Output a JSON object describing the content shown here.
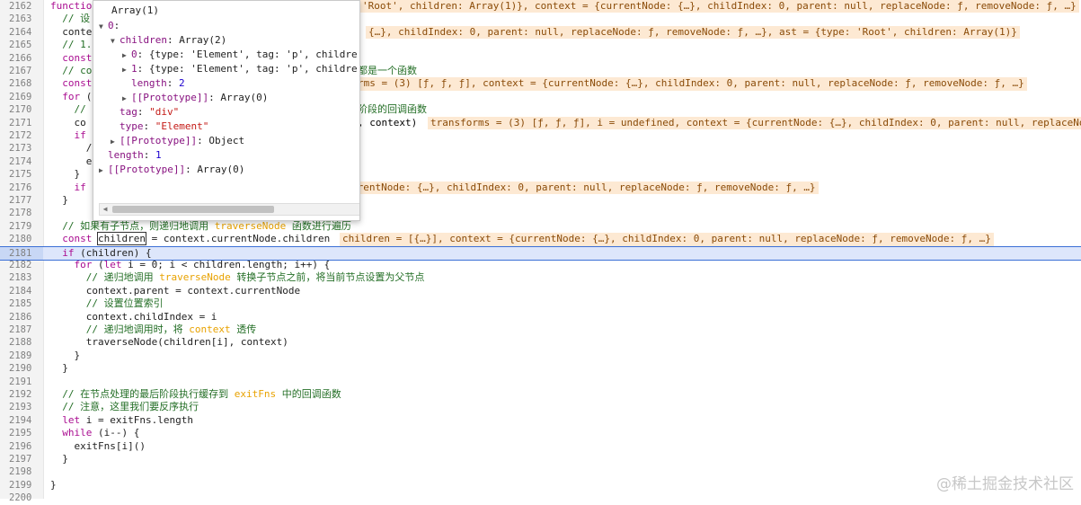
{
  "code": {
    "lines": [
      {
        "n": "2162",
        "t": "functio"
      },
      {
        "n": "2163",
        "t": "  // 设"
      },
      {
        "n": "2164",
        "t": "  conte"
      },
      {
        "n": "2165",
        "t": "  // 1."
      },
      {
        "n": "2166",
        "t": "  const"
      },
      {
        "n": "2167",
        "t": "  // co"
      },
      {
        "n": "2168",
        "t": "  const"
      },
      {
        "n": "2169",
        "t": "  for ("
      },
      {
        "n": "2170",
        "t": "    //"
      },
      {
        "n": "2171",
        "t": "    co"
      },
      {
        "n": "2172",
        "t": "    if"
      },
      {
        "n": "2173",
        "t": "      /"
      },
      {
        "n": "2174",
        "t": "      e"
      },
      {
        "n": "2175",
        "t": "    }"
      },
      {
        "n": "2176",
        "t": "    if"
      },
      {
        "n": "2177",
        "t": "  }"
      },
      {
        "n": "2178",
        "t": ""
      },
      {
        "n": "2179",
        "t": "  // 如果有子节点，则递归地调用 traverseNode 函数进行遍历"
      },
      {
        "n": "2180",
        "t": "  const children = context.currentNode.children"
      },
      {
        "n": "2181",
        "t": "  if (children) {"
      },
      {
        "n": "2182",
        "t": "    for (let i = 0; i < children.length; i++) {"
      },
      {
        "n": "2183",
        "t": "      // 递归地调用 traverseNode 转换子节点之前，将当前节点设置为父节点"
      },
      {
        "n": "2184",
        "t": "      context.parent = context.currentNode"
      },
      {
        "n": "2185",
        "t": "      // 设置位置索引"
      },
      {
        "n": "2186",
        "t": "      context.childIndex = i"
      },
      {
        "n": "2187",
        "t": "      // 递归地调用时，将 context 透传"
      },
      {
        "n": "2188",
        "t": "      traverseNode(children[i], context)"
      },
      {
        "n": "2189",
        "t": "    }"
      },
      {
        "n": "2190",
        "t": "  }"
      },
      {
        "n": "2191",
        "t": ""
      },
      {
        "n": "2192",
        "t": "  // 在节点处理的最后阶段执行缓存到 exitFns 中的回调函数"
      },
      {
        "n": "2193",
        "t": "  // 注意，这里我们要反序执行"
      },
      {
        "n": "2194",
        "t": "  let i = exitFns.length"
      },
      {
        "n": "2195",
        "t": "  while (i--) {"
      },
      {
        "n": "2196",
        "t": "    exitFns[i]()"
      },
      {
        "n": "2197",
        "t": "  }"
      },
      {
        "n": "2198",
        "t": ""
      },
      {
        "n": "2199",
        "t": "}"
      },
      {
        "n": "2200",
        "t": ""
      }
    ],
    "hidden_fragments": {
      "l2167": "都是一个函数",
      "l2170": "阶段的回调函数",
      "l2171": ", context)"
    },
    "inline_values": {
      "l2162": "'Root', children: Array(1)}, context = {currentNode: {…}, childIndex: 0, parent: null, replaceNode: ƒ, removeNode: ƒ, …}",
      "l2164": "{…}, childIndex: 0, parent: null, replaceNode: ƒ, removeNode: ƒ, …}, ast = {type: 'Root', children: Array(1)}",
      "l2168": "rms = (3) [ƒ, ƒ, ƒ], context = {currentNode: {…}, childIndex: 0, parent: null, replaceNode: ƒ, removeNode: ƒ, …}",
      "l2171": "transforms = (3) [ƒ, ƒ, ƒ], i = undefined, context = {currentNode: {…}, childIndex: 0, parent: null, replaceNo",
      "l2176": "rrentNode: {…}, childIndex: 0, parent: null, replaceNode: ƒ, removeNode: ƒ, …}",
      "l2180": "children = [{…}], context = {currentNode: {…}, childIndex: 0, parent: null, replaceNode: ƒ, removeNode: ƒ, …}"
    }
  },
  "popover": {
    "title": "Array(1)",
    "rows": [
      {
        "indent": 0,
        "tri": "▼",
        "key": "0",
        "sep": ":",
        "val": "",
        "vtype": "plain"
      },
      {
        "indent": 1,
        "tri": "▼",
        "key": "children",
        "sep": ": ",
        "val": "Array(2)",
        "vtype": "plain"
      },
      {
        "indent": 2,
        "tri": "▶",
        "key": "0",
        "sep": ": ",
        "val": "{type: 'Element', tag: 'p', childre",
        "vtype": "plain"
      },
      {
        "indent": 2,
        "tri": "▶",
        "key": "1",
        "sep": ": ",
        "val": "{type: 'Element', tag: 'p', childre",
        "vtype": "plain"
      },
      {
        "indent": 2,
        "tri": "",
        "key": "length",
        "sep": ": ",
        "val": "2",
        "vtype": "num"
      },
      {
        "indent": 2,
        "tri": "▶",
        "key": "[[Prototype]]",
        "sep": ": ",
        "val": "Array(0)",
        "vtype": "plain"
      },
      {
        "indent": 1,
        "tri": "",
        "key": "tag",
        "sep": ": ",
        "val": "\"div\"",
        "vtype": "str"
      },
      {
        "indent": 1,
        "tri": "",
        "key": "type",
        "sep": ": ",
        "val": "\"Element\"",
        "vtype": "str"
      },
      {
        "indent": 1,
        "tri": "▶",
        "key": "[[Prototype]]",
        "sep": ": ",
        "val": "Object",
        "vtype": "plain"
      },
      {
        "indent": 0,
        "tri": "",
        "key": "length",
        "sep": ": ",
        "val": "1",
        "vtype": "num"
      },
      {
        "indent": 0,
        "tri": "▶",
        "key": "[[Prototype]]",
        "sep": ": ",
        "val": "Array(0)",
        "vtype": "plain"
      }
    ]
  },
  "watermark": "@稀土掘金技术社区",
  "colors": {
    "keyword": "#aa0d91",
    "comment": "#236e25",
    "inline_bg": "#fde9d3",
    "active_line": "#dde6fb"
  }
}
